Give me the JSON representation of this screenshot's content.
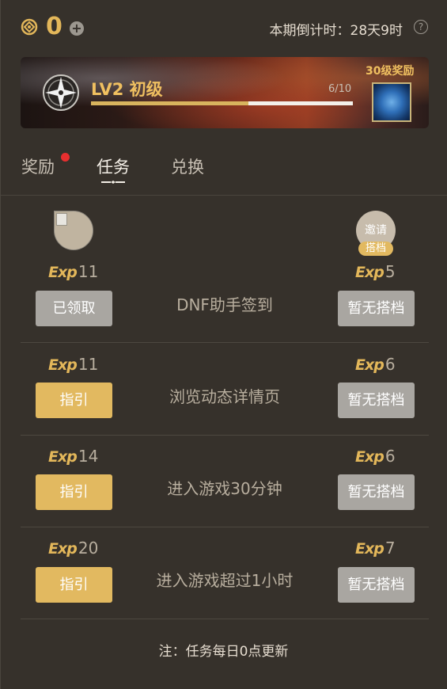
{
  "header": {
    "coin_count": "0",
    "countdown": "本期倒计时：28天9时"
  },
  "level": {
    "title": "LV2 初级",
    "progress_text": "6/10",
    "progress_fraction": 0.6,
    "reward_label": "30级奖励"
  },
  "tabs": [
    {
      "label": "奖励",
      "has_notification": true
    },
    {
      "label": "任务",
      "active": true
    },
    {
      "label": "兑换"
    }
  ],
  "exp_logo": "Exp",
  "invite": {
    "line1": "邀请",
    "badge": "搭档"
  },
  "tasks": [
    {
      "exp": "11",
      "partner_exp": "5",
      "name": "DNF助手签到",
      "action": "已领取",
      "partner_action": "暂无搭档"
    },
    {
      "exp": "11",
      "partner_exp": "6",
      "name": "浏览动态详情页",
      "action": "指引",
      "partner_action": "暂无搭档"
    },
    {
      "exp": "14",
      "partner_exp": "6",
      "name": "进入游戏30分钟",
      "action": "指引",
      "partner_action": "暂无搭档"
    },
    {
      "exp": "20",
      "partner_exp": "7",
      "name": "进入游戏超过1小时",
      "action": "指引",
      "partner_action": "暂无搭档"
    }
  ],
  "footnote": "注：任务每日0点更新",
  "colors": {
    "accent": "#e2b960",
    "background": "#36312b",
    "notification": "#e82f2f"
  }
}
